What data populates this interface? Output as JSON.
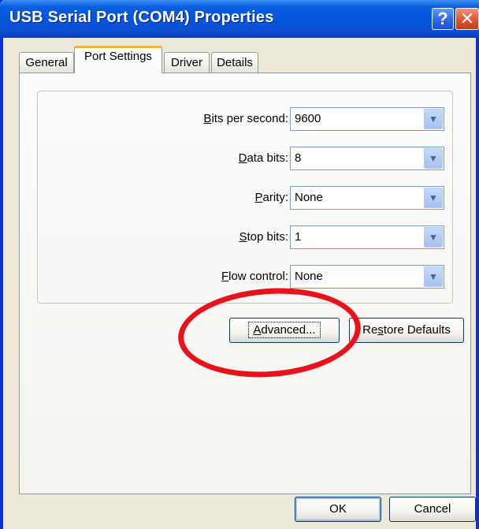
{
  "window": {
    "title": "USB Serial Port (COM4) Properties",
    "help_button": "?",
    "close_button": "✕"
  },
  "tabs": [
    {
      "label": "General",
      "active": false
    },
    {
      "label": "Port Settings",
      "active": true
    },
    {
      "label": "Driver",
      "active": false
    },
    {
      "label": "Details",
      "active": false
    }
  ],
  "settings": {
    "bits_per_second": {
      "label_u": "B",
      "label_rest": "its per second:",
      "value": "9600"
    },
    "data_bits": {
      "label_u": "D",
      "label_rest": "ata bits:",
      "value": "8"
    },
    "parity": {
      "label_u": "P",
      "label_rest": "arity:",
      "value": "None"
    },
    "stop_bits": {
      "label_u": "S",
      "label_rest": "top bits:",
      "value": "1"
    },
    "flow_control": {
      "label_u": "F",
      "label_rest": "low control:",
      "value": "None"
    }
  },
  "buttons": {
    "advanced_u": "A",
    "advanced_rest": "dvanced...",
    "restore_pre": "Re",
    "restore_u": "s",
    "restore_post": "tore Defaults",
    "ok": "OK",
    "cancel": "Cancel"
  },
  "colors": {
    "titlebar": "#0454e0",
    "annotation": "#e8121b",
    "dialog_face": "#ece9d8"
  }
}
